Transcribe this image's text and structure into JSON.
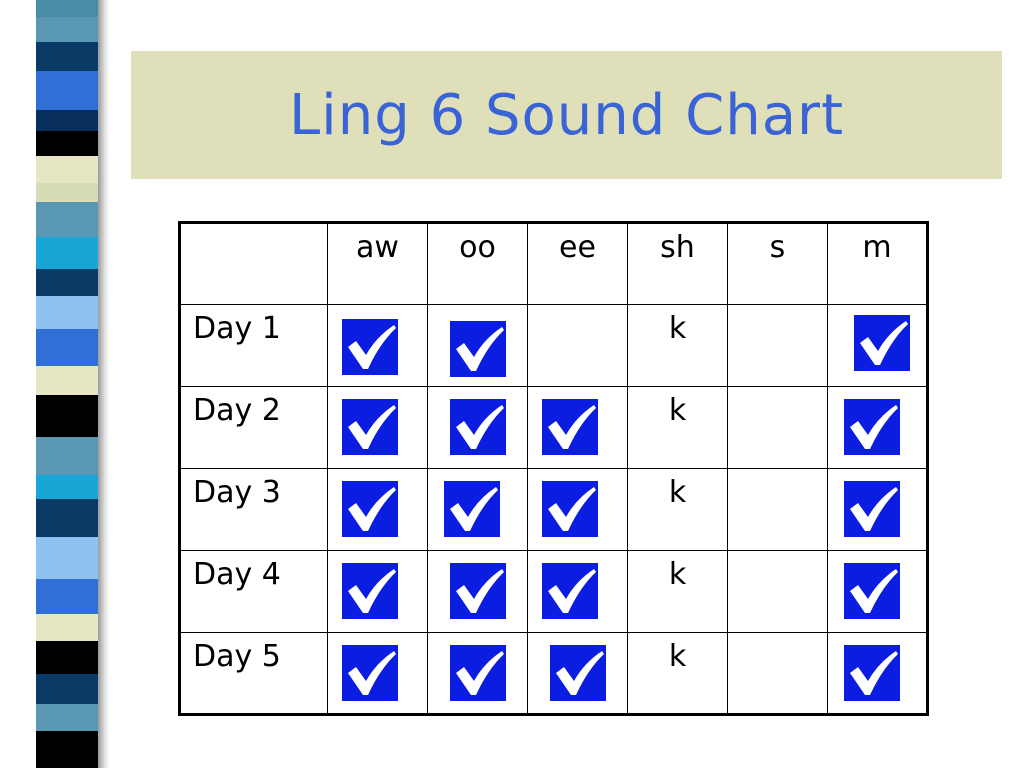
{
  "title": "Ling 6 Sound Chart",
  "colors": {
    "title_text": "#3a63d6",
    "title_bg": "#dfe0b9",
    "check_bg": "#0a1de0"
  },
  "stripes": [
    {
      "color": "#4a8ca6",
      "h": 18
    },
    {
      "color": "#5a97b4",
      "h": 26
    },
    {
      "color": "#0a3a66",
      "h": 30
    },
    {
      "color": "#2f6fd6",
      "h": 40
    },
    {
      "color": "#082e5c",
      "h": 22
    },
    {
      "color": "#000000",
      "h": 26
    },
    {
      "color": "#e6e6c4",
      "h": 28
    },
    {
      "color": "#d8dcb4",
      "h": 20
    },
    {
      "color": "#5a97b4",
      "h": 36
    },
    {
      "color": "#18a6d6",
      "h": 34
    },
    {
      "color": "#0a3a66",
      "h": 28
    },
    {
      "color": "#8fc2f0",
      "h": 34
    },
    {
      "color": "#2f6fd6",
      "h": 38
    },
    {
      "color": "#e6e6c4",
      "h": 30
    },
    {
      "color": "#000000",
      "h": 44
    },
    {
      "color": "#5a97b4",
      "h": 40
    },
    {
      "color": "#18a6d6",
      "h": 24
    },
    {
      "color": "#0a3a66",
      "h": 40
    },
    {
      "color": "#8fc2f0",
      "h": 44
    },
    {
      "color": "#2f6fd6",
      "h": 36
    },
    {
      "color": "#e6e6c4",
      "h": 28
    },
    {
      "color": "#000000",
      "h": 34
    },
    {
      "color": "#0a3a66",
      "h": 32
    },
    {
      "color": "#5a97b4",
      "h": 28
    },
    {
      "color": "#000000",
      "h": 38
    }
  ],
  "table": {
    "columns": [
      "aw",
      "oo",
      "ee",
      "sh",
      "s",
      "m"
    ],
    "rows": [
      {
        "label": "Day 1",
        "cells": [
          "check",
          "check",
          "",
          "k",
          "",
          "check"
        ]
      },
      {
        "label": "Day 2",
        "cells": [
          "check",
          "check",
          "check",
          "k",
          "",
          "check"
        ]
      },
      {
        "label": "Day 3",
        "cells": [
          "check",
          "check",
          "check",
          "k",
          "",
          "check"
        ]
      },
      {
        "label": "Day 4",
        "cells": [
          "check",
          "check",
          "check",
          "k",
          "",
          "check"
        ]
      },
      {
        "label": "Day 5",
        "cells": [
          "check",
          "check",
          "check",
          "k",
          "",
          "check"
        ]
      }
    ]
  }
}
